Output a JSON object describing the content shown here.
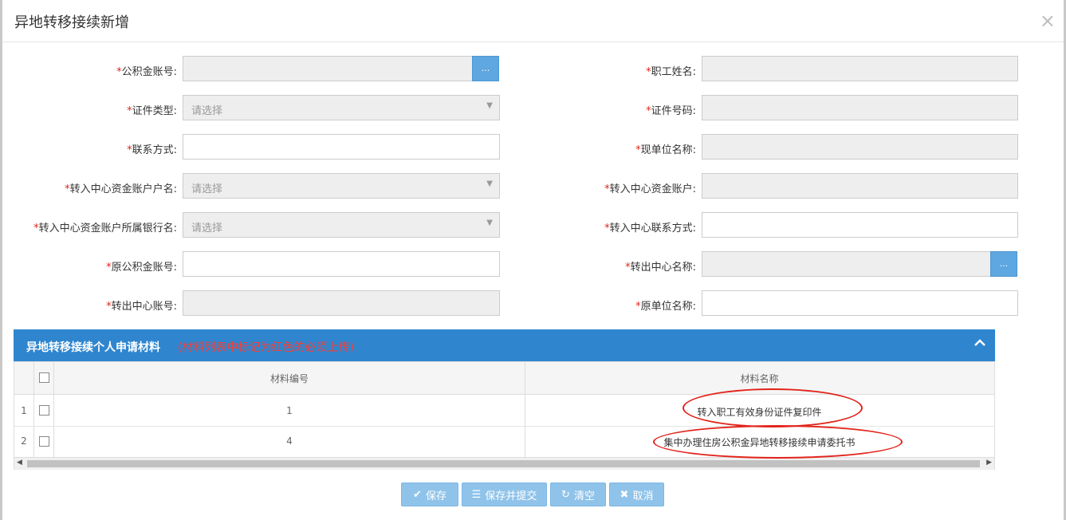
{
  "dialog": {
    "title": "异地转移接续新增",
    "close_icon": "close-icon"
  },
  "form": {
    "required_mark": "*",
    "gjj_account": {
      "label": "公积金账号:"
    },
    "employee_name": {
      "label": "职工姓名:"
    },
    "id_type": {
      "label": "证件类型:",
      "placeholder": "请选择"
    },
    "id_number": {
      "label": "证件号码:"
    },
    "contact": {
      "label": "联系方式:"
    },
    "current_unit": {
      "label": "现单位名称:"
    },
    "in_account_name": {
      "label": "转入中心资金账户户名:",
      "placeholder": "请选择"
    },
    "in_account": {
      "label": "转入中心资金账户:"
    },
    "in_bank": {
      "label": "转入中心资金账户所属银行名:",
      "placeholder": "请选择"
    },
    "in_contact": {
      "label": "转入中心联系方式:"
    },
    "orig_account": {
      "label": "原公积金账号:"
    },
    "out_center_name": {
      "label": "转出中心名称:"
    },
    "out_center_account": {
      "label": "转出中心账号:"
    },
    "orig_unit": {
      "label": "原单位名称:"
    },
    "lookup_button": "..."
  },
  "materials": {
    "title": "异地转移接续个人申请材料",
    "note": "(材料列表中标记为红色的必须上传)",
    "columns": [
      "材料编号",
      "材料名称"
    ],
    "rows": [
      {
        "index": "1",
        "code": "1",
        "name": "转入职工有效身份证件复印件"
      },
      {
        "index": "2",
        "code": "4",
        "name": "集中办理住房公积金异地转移接续申请委托书"
      }
    ]
  },
  "buttons": {
    "save": "保存",
    "save_submit": "保存并提交",
    "clear": "清空",
    "cancel": "取消"
  },
  "colors": {
    "accent": "#2f86cf",
    "required": "#e2231a",
    "button": "#8fc3ea"
  }
}
